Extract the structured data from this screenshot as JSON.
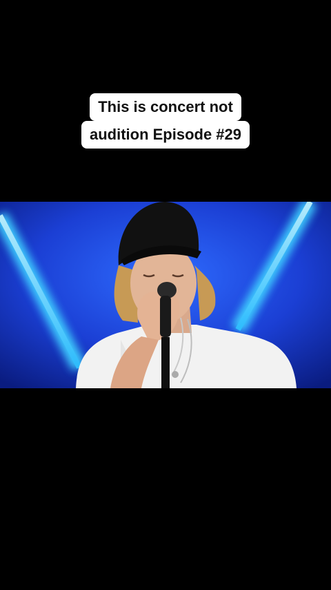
{
  "caption": {
    "line1": "This is concert not",
    "line2": "audition Episode #29"
  },
  "video": {
    "scene": "singer-performing-on-stage",
    "background_color": "#1a3fd0",
    "light_beam_color": "#4fd8ff"
  },
  "colors": {
    "page_background": "#000000",
    "caption_background": "#ffffff",
    "caption_text": "#111111"
  }
}
